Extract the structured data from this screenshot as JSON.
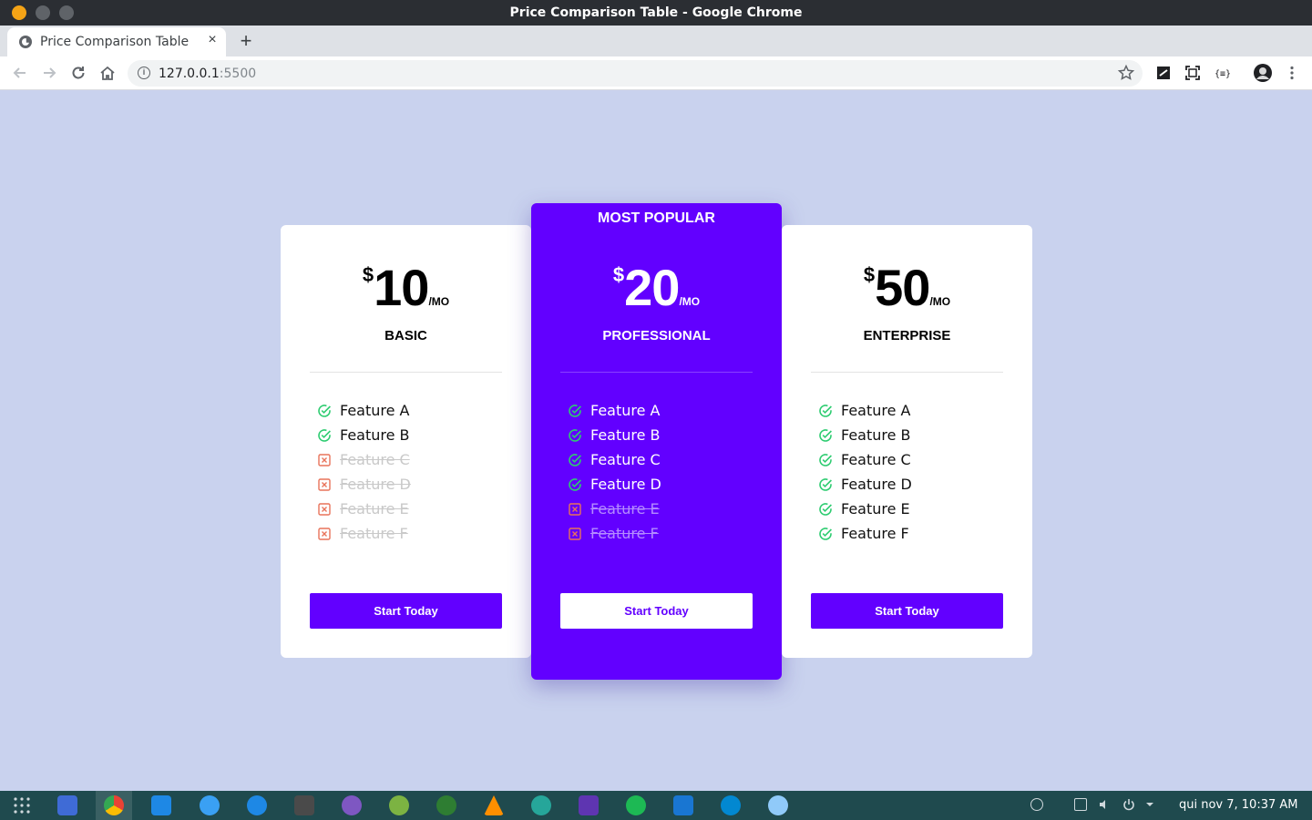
{
  "window": {
    "title": "Price Comparison Table - Google Chrome"
  },
  "browser": {
    "tab_title": "Price Comparison Table",
    "tab_close": "×",
    "new_tab": "+",
    "url_host": "127.0.0.1",
    "url_port": ":5500"
  },
  "pricing": {
    "popular_label": "MOST POPULAR",
    "plans": [
      {
        "currency": "$",
        "amount": "10",
        "period": "/MO",
        "name": "BASIC",
        "features": [
          {
            "label": "Feature A",
            "included": true
          },
          {
            "label": "Feature B",
            "included": true
          },
          {
            "label": "Feature C",
            "included": false
          },
          {
            "label": "Feature D",
            "included": false
          },
          {
            "label": "Feature E",
            "included": false
          },
          {
            "label": "Feature F",
            "included": false
          }
        ],
        "cta": "Start Today"
      },
      {
        "currency": "$",
        "amount": "20",
        "period": "/MO",
        "name": "PROFESSIONAL",
        "features": [
          {
            "label": "Feature A",
            "included": true
          },
          {
            "label": "Feature B",
            "included": true
          },
          {
            "label": "Feature C",
            "included": true
          },
          {
            "label": "Feature D",
            "included": true
          },
          {
            "label": "Feature E",
            "included": false
          },
          {
            "label": "Feature F",
            "included": false
          }
        ],
        "cta": "Start Today"
      },
      {
        "currency": "$",
        "amount": "50",
        "period": "/MO",
        "name": "ENTERPRISE",
        "features": [
          {
            "label": "Feature A",
            "included": true
          },
          {
            "label": "Feature B",
            "included": true
          },
          {
            "label": "Feature C",
            "included": true
          },
          {
            "label": "Feature D",
            "included": true
          },
          {
            "label": "Feature E",
            "included": true
          },
          {
            "label": "Feature F",
            "included": true
          }
        ],
        "cta": "Start Today"
      }
    ]
  },
  "colors": {
    "accent": "#6200ff",
    "page_background": "#c9d2ee",
    "check": "#2ecc71",
    "cross": "#e8735a"
  },
  "taskbar": {
    "clock": "qui nov  7, 10:37 AM"
  }
}
